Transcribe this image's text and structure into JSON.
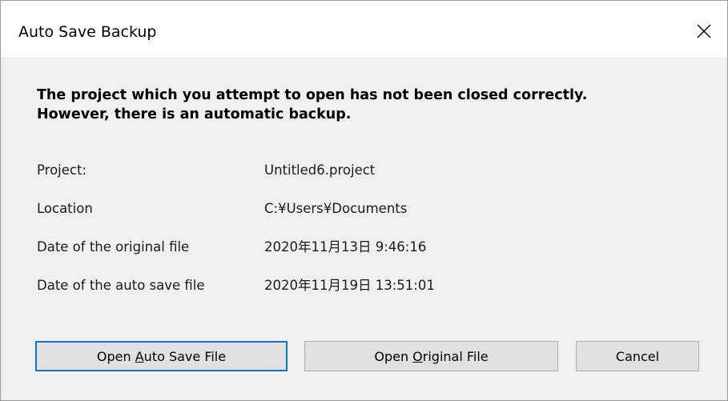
{
  "window": {
    "title": "Auto Save Backup"
  },
  "message": {
    "line1": "The project which you attempt to open has not been closed correctly.",
    "line2": "However, there is an automatic backup."
  },
  "info": [
    {
      "label": "Project:",
      "value": "Untitled6.project"
    },
    {
      "label": "Location",
      "value": "C:¥Users¥Documents"
    },
    {
      "label": "Date of the original file",
      "value": "2020年11月13日 9:46:16"
    },
    {
      "label": "Date of the auto save file",
      "value": "2020年11月19日 13:51:01"
    }
  ],
  "buttons": {
    "open_auto": {
      "pre": "Open ",
      "mnemonic": "A",
      "post": "uto Save File"
    },
    "open_original": {
      "pre": "Open ",
      "mnemonic": "O",
      "post": "riginal File"
    },
    "cancel": "Cancel"
  },
  "icons": {
    "close": "close-icon"
  },
  "colors": {
    "focus_border": "#0078d7",
    "button_face": "#e1e1e1",
    "dialog_background": "#f0f0f0"
  }
}
